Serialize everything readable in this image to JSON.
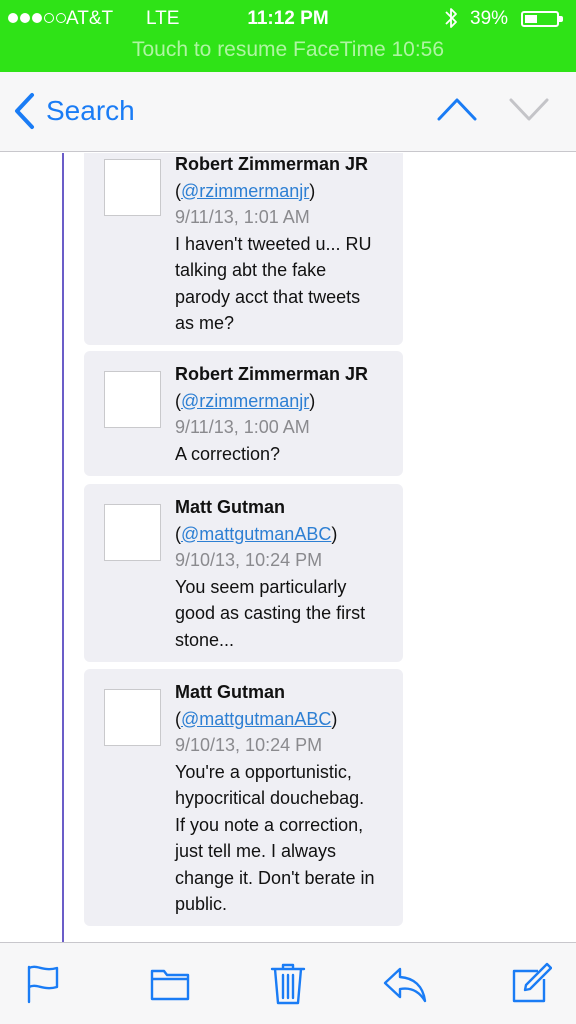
{
  "status_bar": {
    "signal_filled": 3,
    "signal_total": 5,
    "carrier": "AT&T",
    "network": "LTE",
    "time": "11:12 PM",
    "battery_percent": "39%",
    "battery_level": 0.39,
    "banner": "Touch to resume FaceTime 10:56",
    "background_color": "#2fe317"
  },
  "nav": {
    "back_label": "Search",
    "back_icon": "chevron-left-icon",
    "up_icon": "chevron-up-icon",
    "down_icon": "chevron-down-icon",
    "accent_color": "#1a7cf5"
  },
  "tweets": [
    {
      "author": "Robert Zimmerman JR",
      "open_paren": "(",
      "handle": "@rzimmermanjr",
      "close_paren": ")",
      "timestamp": "9/11/13, 1:01 AM",
      "text_lines": [
        "I haven't tweeted u... RU",
        "talking abt the fake",
        "parody acct that tweets",
        "as me?"
      ]
    },
    {
      "author": "Robert Zimmerman JR",
      "open_paren": "(",
      "handle": "@rzimmermanjr",
      "close_paren": ")",
      "timestamp": "9/11/13, 1:00 AM",
      "text_lines": [
        "A correction?"
      ]
    },
    {
      "author": "Matt Gutman",
      "open_paren": "(",
      "handle": "@mattgutmanABC",
      "close_paren": ")",
      "timestamp": "9/10/13, 10:24 PM",
      "text_lines": [
        "You seem particularly",
        "good as casting the first",
        "stone..."
      ]
    },
    {
      "author": "Matt Gutman",
      "open_paren": "(",
      "handle": "@mattgutmanABC",
      "close_paren": ")",
      "timestamp": "9/10/13, 10:24 PM",
      "text_lines": [
        "You're a opportunistic,",
        "hypocritical douchebag.",
        "If you note a correction,",
        "just tell me. I always",
        "change it. Don't berate in",
        "public."
      ]
    }
  ],
  "toolbar": {
    "items": [
      {
        "icon": "flag-icon"
      },
      {
        "icon": "folder-icon"
      },
      {
        "icon": "trash-icon"
      },
      {
        "icon": "reply-icon"
      },
      {
        "icon": "compose-icon"
      }
    ],
    "accent_color": "#1a7cf5"
  }
}
